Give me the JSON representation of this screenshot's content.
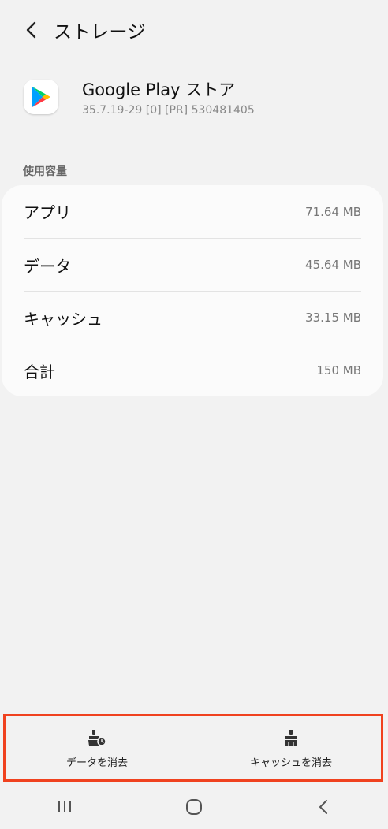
{
  "header": {
    "title": "ストレージ",
    "back_icon": "chevron-left-icon"
  },
  "app": {
    "name": "Google Play ストア",
    "version": "35.7.19-29 [0] [PR] 530481405",
    "icon": "google-play-icon"
  },
  "usage": {
    "section_label": "使用容量",
    "rows": [
      {
        "label": "アプリ",
        "value": "71.64 MB"
      },
      {
        "label": "データ",
        "value": "45.64 MB"
      },
      {
        "label": "キャッシュ",
        "value": "33.15 MB"
      },
      {
        "label": "合計",
        "value": "150 MB"
      }
    ]
  },
  "actions": {
    "clear_data_label": "データを消去",
    "clear_cache_label": "キャッシュを消去"
  },
  "colors": {
    "background": "#f2f2f2",
    "card": "#fbfbfb",
    "highlight": "#f0421f"
  },
  "nav": {
    "recents_icon": "recents-icon",
    "home_icon": "home-icon",
    "back_icon": "back-icon"
  }
}
